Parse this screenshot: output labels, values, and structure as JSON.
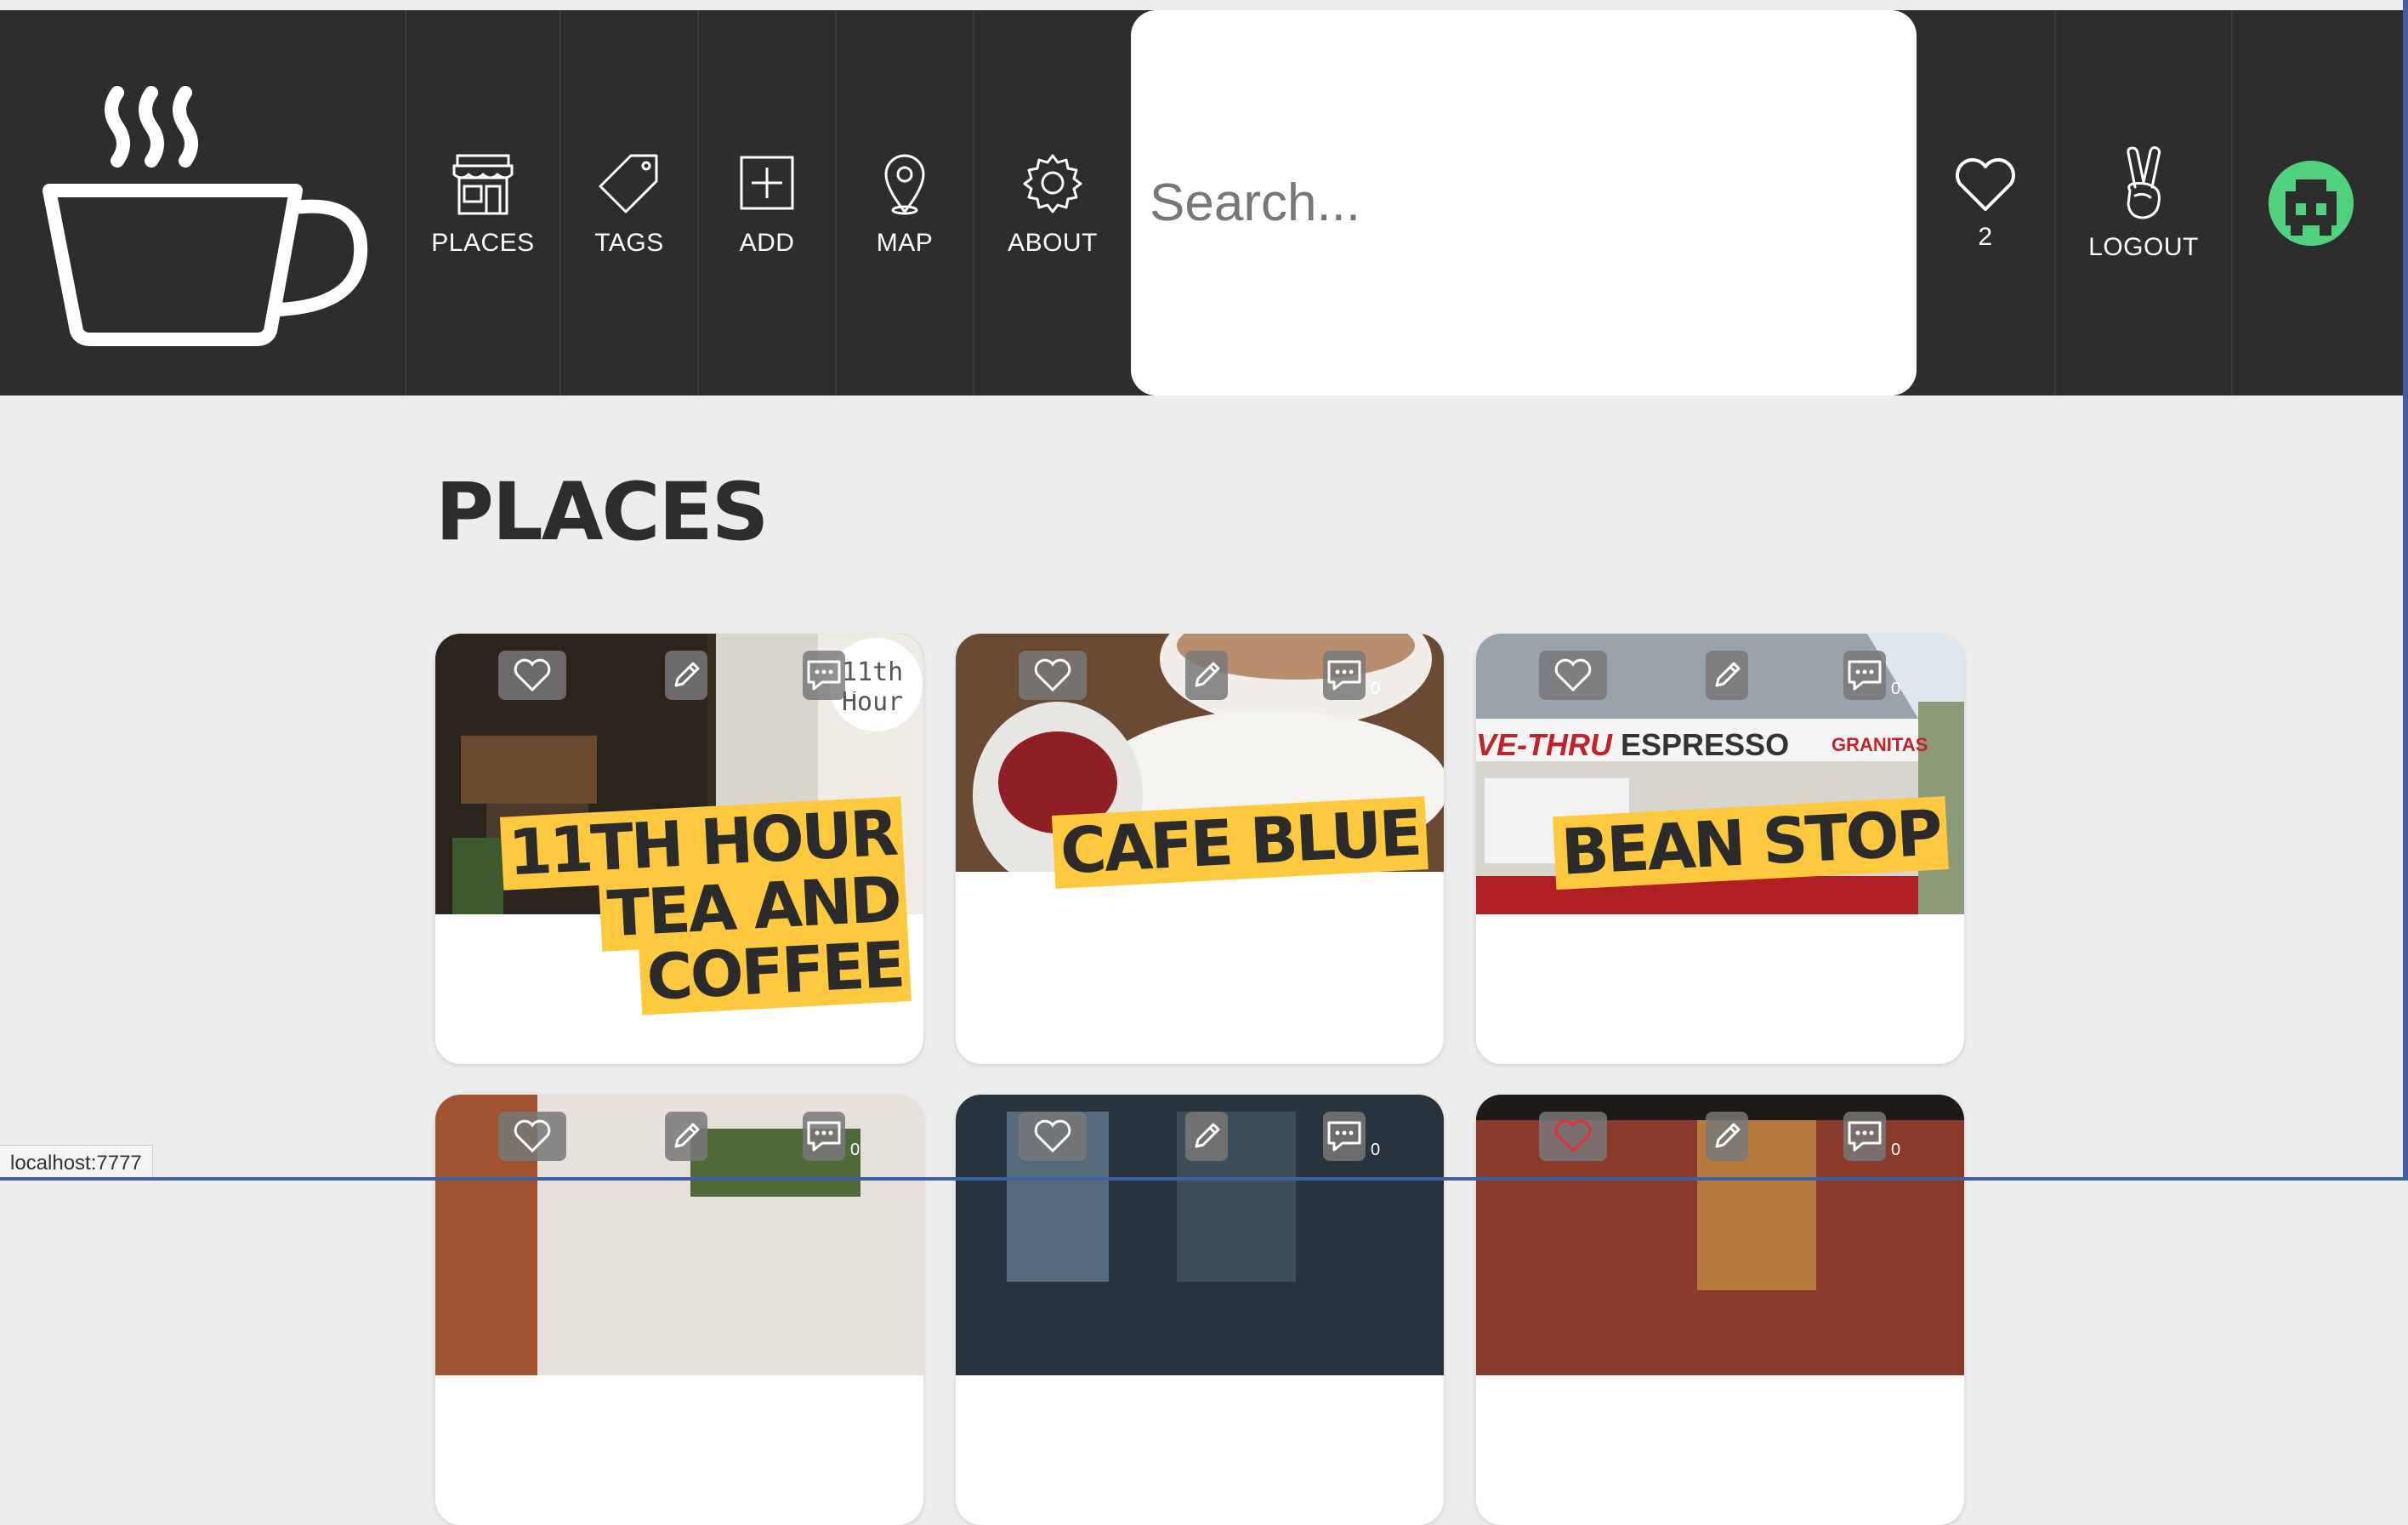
{
  "nav": {
    "items": [
      {
        "label": "PLACES",
        "icon": "storefront-icon"
      },
      {
        "label": "TAGS",
        "icon": "tag-icon"
      },
      {
        "label": "ADD",
        "icon": "plus-square-icon"
      },
      {
        "label": "MAP",
        "icon": "map-pin-icon"
      },
      {
        "label": "ABOUT",
        "icon": "gear-icon"
      }
    ],
    "search_placeholder": "Search...",
    "favorites_count": "2",
    "logout_label": "LOGOUT"
  },
  "page": {
    "title": "PLACES"
  },
  "cards": [
    {
      "name": "11TH HOUR TEA AND COFFEE",
      "comments": "0",
      "favorited": false
    },
    {
      "name": "CAFE BLUE",
      "comments": "0",
      "favorited": false
    },
    {
      "name": "BEAN STOP",
      "comments": "0",
      "favorited": false
    },
    {
      "name": "",
      "comments": "0",
      "favorited": false
    },
    {
      "name": "",
      "comments": "0",
      "favorited": false
    },
    {
      "name": "",
      "comments": "0",
      "favorited": true
    }
  ],
  "photo_text": {
    "card1_sign": "11th Hour",
    "card3_sign_left": "VE-THRU",
    "card3_sign_center": "ESPRESSO",
    "card3_sign_right": "GRANITAS"
  },
  "status_bar": "localhost:7777",
  "colors": {
    "nav_bg": "#2d2d2d",
    "banner": "#ffc93f",
    "avatar": "#4fd17e",
    "heart_active": "#e0303a"
  }
}
